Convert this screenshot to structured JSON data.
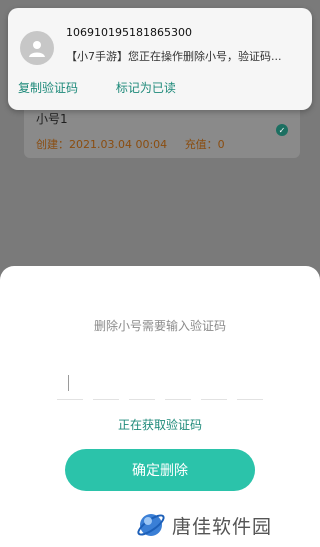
{
  "background_card": {
    "title": "小号1",
    "created": "创建：2021.03.04 00:04",
    "recharge": "充值：0"
  },
  "notification": {
    "sender": "106910195181865300",
    "body": "【小7手游】您正在操作删除小号，验证码...",
    "actions": [
      "复制验证码",
      "标记为已读"
    ]
  },
  "sheet": {
    "title": "删除小号需要输入验证码",
    "code_value": "",
    "status": "正在获取验证码",
    "confirm_label": "确定删除"
  },
  "watermark": {
    "text": "唐佳软件园"
  },
  "colors": {
    "accent": "#2bc3aa",
    "link": "#1e8a7a",
    "overlay": "#7a7a7a"
  }
}
